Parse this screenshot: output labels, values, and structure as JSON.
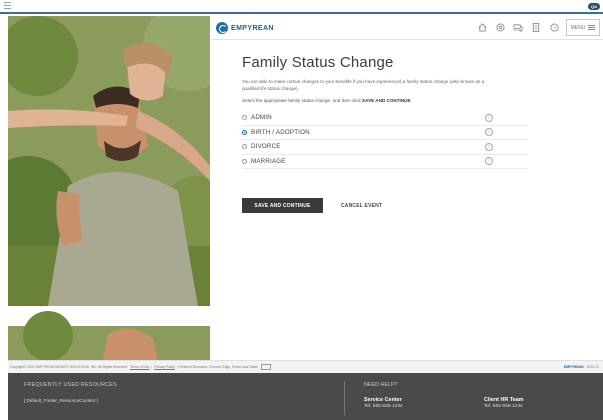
{
  "topbar": {
    "menu_icon": "hamburger-icon",
    "badge": "QA"
  },
  "header": {
    "logo_text": "EMPYREAN",
    "icons": [
      "home-icon",
      "support-icon",
      "chat-icon",
      "document-icon",
      "help-icon"
    ],
    "menu_label": "MENU"
  },
  "main": {
    "title": "Family Status Change",
    "intro": "You are able to make certain changes to your benefits if you have experienced a family status change (also known as a qualified life status change).",
    "instruction_prefix": "Select the appropriate family status change, and then click ",
    "instruction_bold": "SAVE AND CONTINUE",
    "instruction_suffix": ".",
    "options": [
      {
        "label": "ADMIN",
        "selected": false
      },
      {
        "label": "BIRTH / ADOPTION",
        "selected": true
      },
      {
        "label": "DIVORCE",
        "selected": false
      },
      {
        "label": "MARRIAGE",
        "selected": false
      }
    ],
    "save_label": "SAVE AND CONTINUE",
    "cancel_label": "CANCEL EVENT"
  },
  "copyright": {
    "text": "Copyright© 2021 EMPYREAN BENEFIT SOLUTIONS, INC. All Rights Reserved.",
    "terms": "Terms of Use",
    "privacy": "Privacy Policy",
    "browsers": "Preferred Browsers: Chrome, Edge, Firefox and Safari",
    "logo": "EMPYREAN",
    "version": "2023.11"
  },
  "footer": {
    "resources_heading": "FREQUENTLY USED RESOURCES",
    "resource_item": "[ Default_Footer_ResourceContent ]",
    "help_heading": "NEED HELP?",
    "service_name": "Service Center",
    "service_tel": "Tel: 555-555-1234",
    "hr_name": "Client HR Team",
    "hr_tel": "Tel: 555-555-1234"
  },
  "colors": {
    "accent": "#1e6fb0",
    "footer_bg": "#4a4a4a",
    "button_bg": "#3a3a3a"
  }
}
